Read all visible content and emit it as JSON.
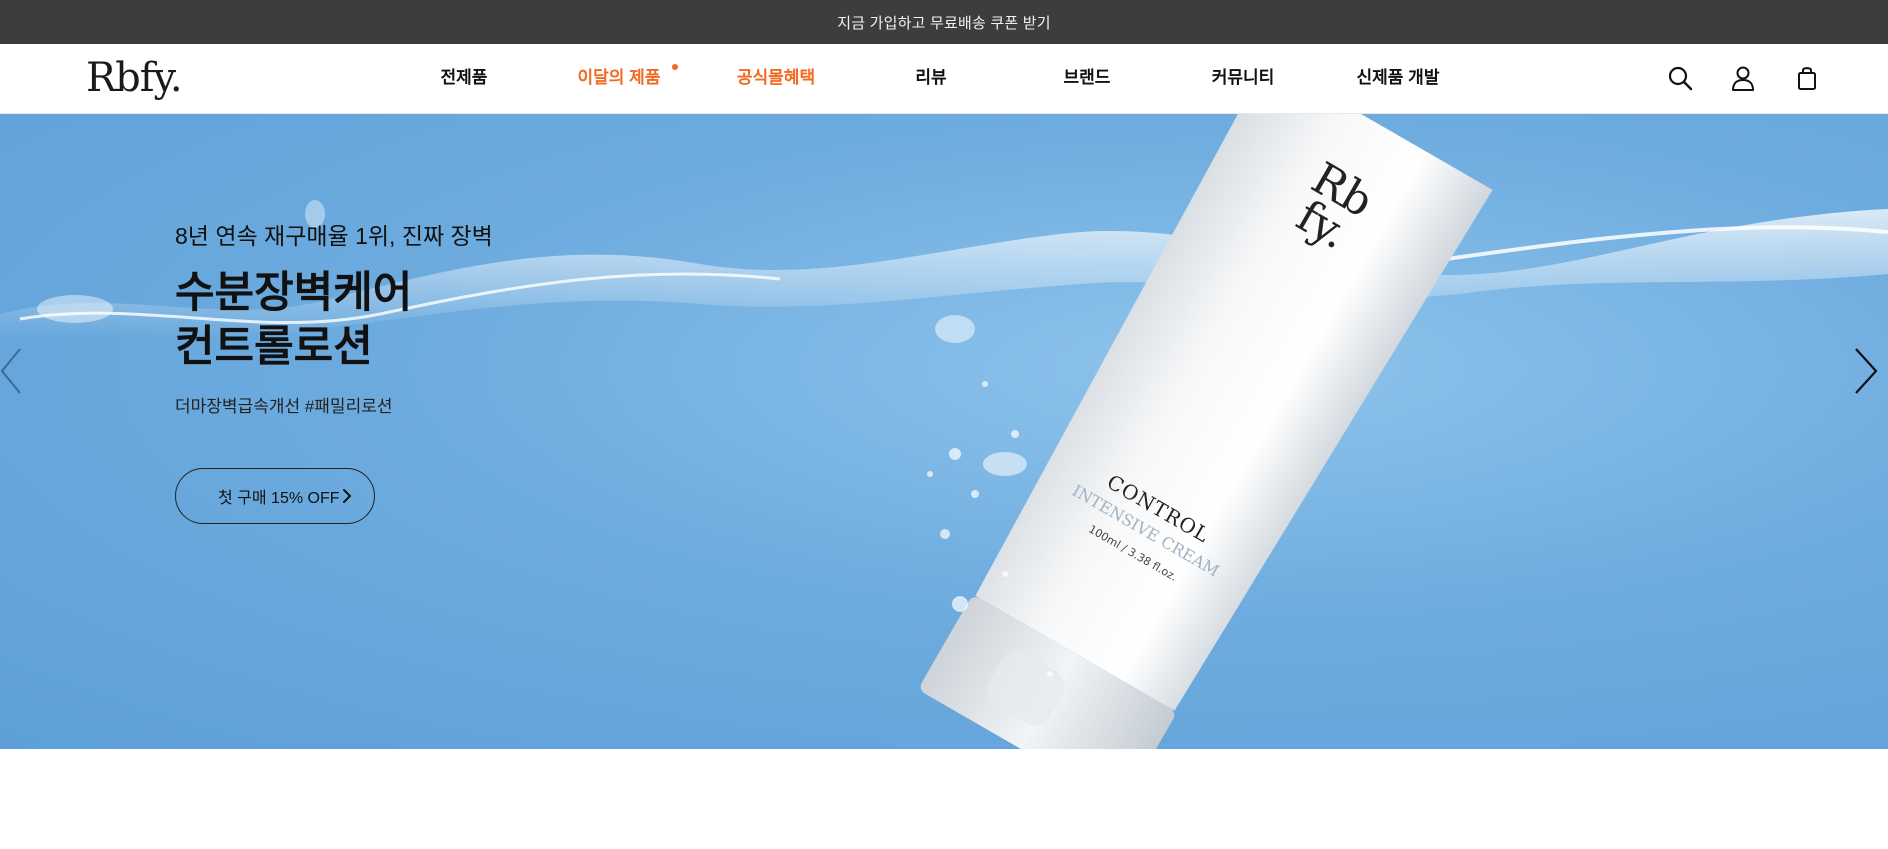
{
  "promo": {
    "text": "지금 가입하고 무료배송 쿠폰 받기"
  },
  "header": {
    "logo": "Rbfy.",
    "nav": [
      {
        "label": "전제품",
        "accent": false,
        "dot": false
      },
      {
        "label": "이달의 제품",
        "accent": true,
        "dot": true
      },
      {
        "label": "공식몰혜택",
        "accent": true,
        "dot": false
      },
      {
        "label": "리뷰",
        "accent": false,
        "dot": false
      },
      {
        "label": "브랜드",
        "accent": false,
        "dot": false
      },
      {
        "label": "커뮤니티",
        "accent": false,
        "dot": false
      },
      {
        "label": "신제품 개발",
        "accent": false,
        "dot": false
      }
    ],
    "icons": [
      "search-icon",
      "user-icon",
      "shopping-bag-icon"
    ],
    "accent_color": "#f26a21"
  },
  "hero": {
    "eyebrow": "8년 연속 재구매율 1위, 진짜 장벽",
    "headline_line1": "수분장벽케어",
    "headline_line2": "컨트롤로션",
    "subtitle": "더마장벽급속개선 #패밀리로션",
    "cta": "첫 구매 15% OFF",
    "product": {
      "brand_mark_line1": "Rb",
      "brand_mark_line2": "fy.",
      "name": "CONTROL",
      "variant": "INTENSIVE CREAM",
      "volume": "100ml / 3.38 fl.oz."
    },
    "background_color": "#6eacdf"
  }
}
